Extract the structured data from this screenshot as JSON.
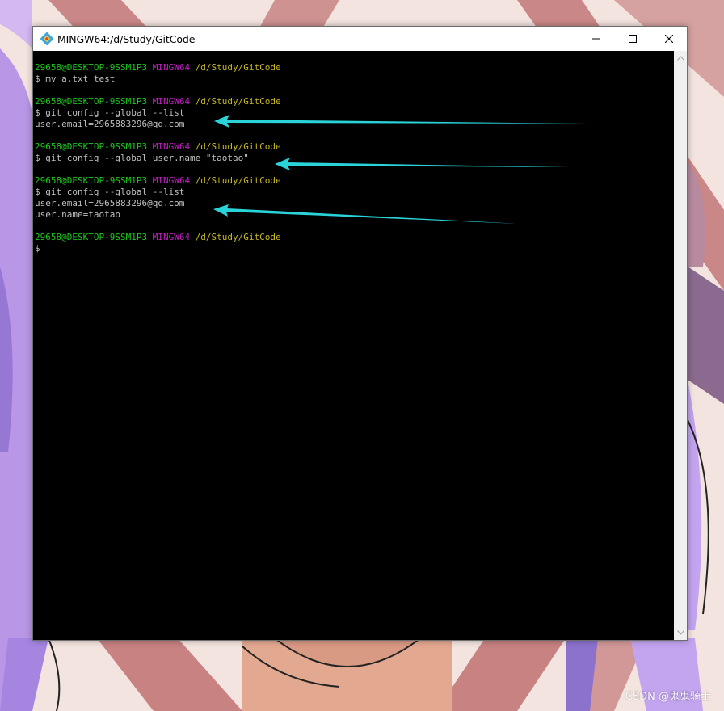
{
  "window": {
    "title": "MINGW64:/d/Study/GitCode",
    "controls": {
      "minimize_icon": "minimize-icon",
      "maximize_icon": "maximize-icon",
      "close_icon": "close-icon"
    },
    "app_icon": "git-icon"
  },
  "terminal": {
    "colors": {
      "background": "#000000",
      "text": "#c0c0c0",
      "user": "#1cc61c",
      "system": "#c21ec2",
      "path": "#c8b820"
    },
    "lines": [
      {
        "type": "prompt",
        "user": "29658@DESKTOP-9SSM1P3",
        "system": "MINGW64",
        "path": "/d/Study/GitCode"
      },
      {
        "type": "text",
        "text": "$ mv a.txt test"
      },
      {
        "type": "blank",
        "text": ""
      },
      {
        "type": "prompt",
        "user": "29658@DESKTOP-9SSM1P3",
        "system": "MINGW64",
        "path": "/d/Study/GitCode"
      },
      {
        "type": "text",
        "text": "$ git config --global --list"
      },
      {
        "type": "text",
        "text": "user.email=2965883296@qq.com"
      },
      {
        "type": "blank",
        "text": ""
      },
      {
        "type": "prompt",
        "user": "29658@DESKTOP-9SSM1P3",
        "system": "MINGW64",
        "path": "/d/Study/GitCode"
      },
      {
        "type": "text",
        "text": "$ git config --global user.name \"taotao\""
      },
      {
        "type": "blank",
        "text": ""
      },
      {
        "type": "prompt",
        "user": "29658@DESKTOP-9SSM1P3",
        "system": "MINGW64",
        "path": "/d/Study/GitCode"
      },
      {
        "type": "text",
        "text": "$ git config --global --list"
      },
      {
        "type": "text",
        "text": "user.email=2965883296@qq.com"
      },
      {
        "type": "text",
        "text": "user.name=taotao"
      },
      {
        "type": "blank",
        "text": ""
      },
      {
        "type": "prompt",
        "user": "29658@DESKTOP-9SSM1P3",
        "system": "MINGW64",
        "path": "/d/Study/GitCode"
      },
      {
        "type": "text",
        "text": "$"
      }
    ]
  },
  "annotations": {
    "arrow_color": "#2ad3d8"
  },
  "watermark": {
    "text": "CSDN @鬼鬼骑士"
  }
}
